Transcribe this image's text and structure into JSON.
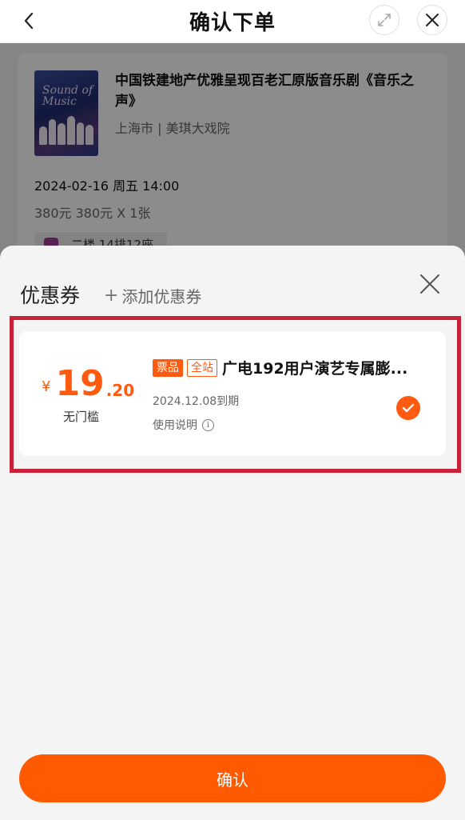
{
  "header": {
    "title": "确认下单"
  },
  "order": {
    "show_name": "中国铁建地产优雅呈现百老汇原版音乐剧《音乐之声》",
    "poster_text": "Sound of Music",
    "venue": "上海市 | 美琪大戏院",
    "datetime": "2024-02-16 周五 14:00",
    "price_line": "380元 380元 X 1张",
    "seat": "二楼 14排12座"
  },
  "coupon_sheet": {
    "title": "优惠券",
    "add_label": "添加优惠券",
    "coupon": {
      "currency": "¥",
      "amount_int": "19",
      "amount_dec": ".20",
      "threshold": "无门槛",
      "tag_1": "票品",
      "tag_2": "全站",
      "name": "广电192用户演艺专属膨...",
      "expiry": "2024.12.08到期",
      "usage": "使用说明",
      "selected": true
    },
    "confirm_label": "确认"
  },
  "colors": {
    "accent": "#ff5a10",
    "highlight_border": "#c8213a"
  }
}
